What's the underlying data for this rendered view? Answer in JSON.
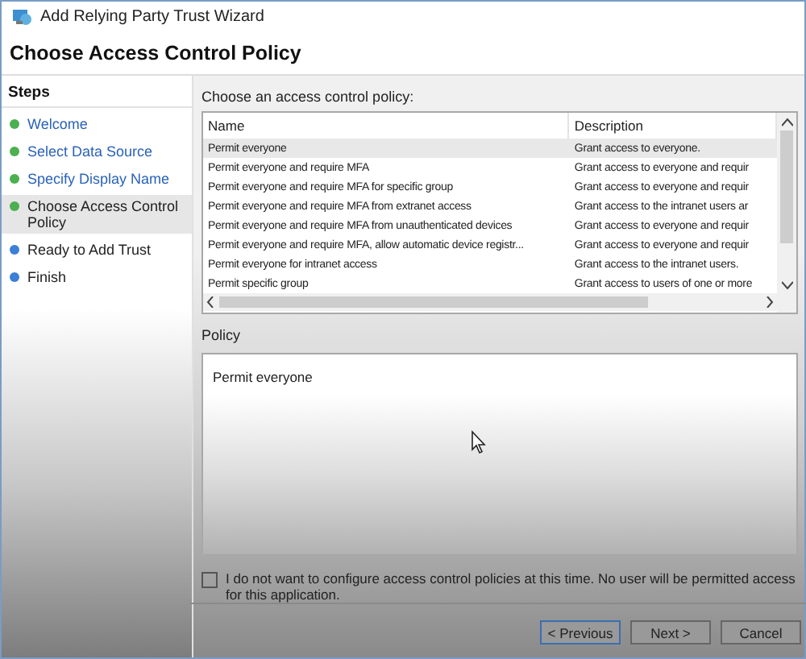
{
  "window": {
    "title": "Add Relying Party Trust Wizard"
  },
  "header": {
    "title": "Choose Access Control Policy"
  },
  "steps": {
    "title": "Steps",
    "items": [
      {
        "label": "Welcome",
        "completed": true,
        "selected": false
      },
      {
        "label": "Select Data Source",
        "completed": true,
        "selected": false
      },
      {
        "label": "Specify Display Name",
        "completed": true,
        "selected": false
      },
      {
        "label": "Choose Access Control Policy",
        "completed": true,
        "selected": true
      },
      {
        "label": "Ready to Add Trust",
        "completed": false,
        "selected": false
      },
      {
        "label": "Finish",
        "completed": false,
        "selected": false
      }
    ]
  },
  "policy_list": {
    "label": "Choose an access control policy:",
    "columns": [
      "Name",
      "Description"
    ],
    "rows": [
      {
        "name": "Permit everyone",
        "description": "Grant access to everyone.",
        "selected": true
      },
      {
        "name": "Permit everyone and require MFA",
        "description": "Grant access to everyone and requir",
        "selected": false
      },
      {
        "name": "Permit everyone and require MFA for specific group",
        "description": "Grant access to everyone and requir",
        "selected": false
      },
      {
        "name": "Permit everyone and require MFA from extranet access",
        "description": "Grant access to the intranet users ar",
        "selected": false
      },
      {
        "name": "Permit everyone and require MFA from unauthenticated devices",
        "description": "Grant access to everyone and requir",
        "selected": false
      },
      {
        "name": "Permit everyone and require MFA, allow automatic device registr...",
        "description": "Grant access to everyone and requir",
        "selected": false
      },
      {
        "name": "Permit everyone for intranet access",
        "description": "Grant access to the intranet users.",
        "selected": false
      },
      {
        "name": "Permit specific group",
        "description": "Grant access to users of one or more",
        "selected": false
      }
    ]
  },
  "policy": {
    "label": "Policy",
    "text": "Permit everyone"
  },
  "opt_out": {
    "label": "I do not want to configure access control policies at this time. No user will be permitted access for this application.",
    "checked": false
  },
  "buttons": [
    {
      "label": "< Previous",
      "default": true
    },
    {
      "label": "Next >",
      "default": false
    },
    {
      "label": "Cancel",
      "default": false
    }
  ]
}
